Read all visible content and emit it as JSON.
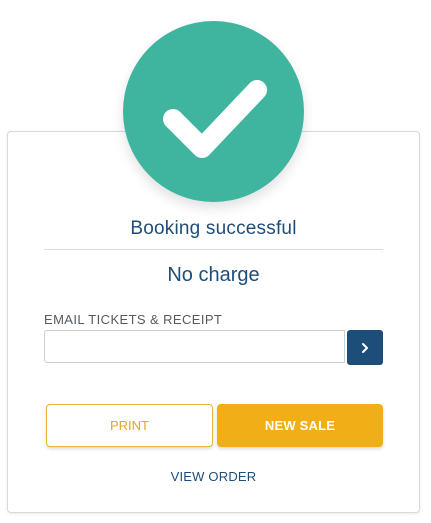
{
  "status": {
    "icon": "checkmark-icon",
    "color": "#3fb59f",
    "title": "Booking successful",
    "charge": "No charge"
  },
  "email": {
    "label": "EMAIL TICKETS & RECEIPT",
    "value": "",
    "placeholder": "",
    "submit_icon": "chevron-right-icon"
  },
  "actions": {
    "print_label": "PRINT",
    "new_sale_label": "NEW SALE",
    "view_order_label": "VIEW ORDER"
  },
  "colors": {
    "accent": "#f2ae16",
    "primary": "#1d4e7a",
    "success": "#3fb59f"
  }
}
